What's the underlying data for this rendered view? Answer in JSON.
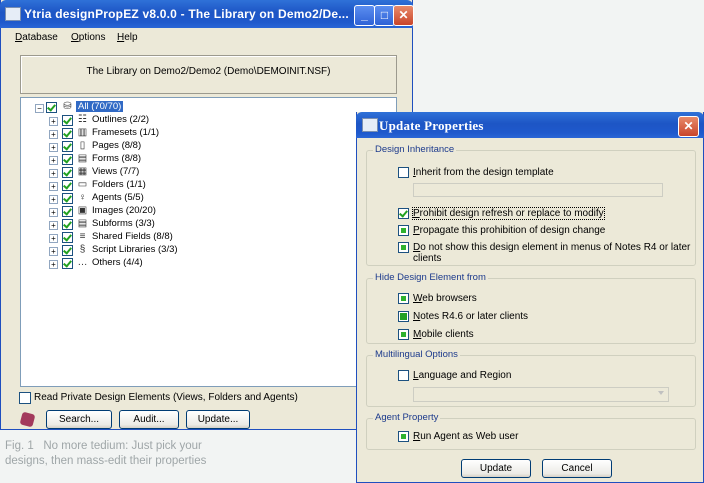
{
  "main": {
    "title": "Ytria designPropEZ v8.0.0 - The Library on Demo2/De...",
    "menu": [
      "Database",
      "Options",
      "Help"
    ],
    "database_path": "The Library on Demo2/Demo2 (Demo\\DEMOINIT.NSF)",
    "tree": [
      {
        "label": "All (70/70)",
        "icon": "database-icon",
        "selected": true
      },
      {
        "label": "Outlines (2/2)",
        "icon": "outline-icon"
      },
      {
        "label": "Framesets (1/1)",
        "icon": "frameset-icon"
      },
      {
        "label": "Pages (8/8)",
        "icon": "page-icon"
      },
      {
        "label": "Forms (8/8)",
        "icon": "form-icon"
      },
      {
        "label": "Views (7/7)",
        "icon": "view-icon"
      },
      {
        "label": "Folders (1/1)",
        "icon": "folder-icon"
      },
      {
        "label": "Agents (5/5)",
        "icon": "agent-icon"
      },
      {
        "label": "Images (20/20)",
        "icon": "image-icon"
      },
      {
        "label": "Subforms (3/3)",
        "icon": "subform-icon"
      },
      {
        "label": "Shared Fields (8/8)",
        "icon": "shared-field-icon"
      },
      {
        "label": "Script Libraries (3/3)",
        "icon": "script-library-icon"
      },
      {
        "label": "Others (4/4)",
        "icon": "ellipsis-icon"
      }
    ],
    "read_private_label": "Read Private Design Elements (Views, Folders and Agents)",
    "buttons": {
      "search": "Search...",
      "audit": "Audit...",
      "update": "Update..."
    }
  },
  "dialog": {
    "title": "Update Properties",
    "design_inheritance": {
      "heading": "Design Inheritance",
      "inherit": "Inherit from the design template",
      "prohibit": "Prohibit design refresh or replace to modify",
      "propagate": "Propagate this prohibition of design change",
      "do_not_show_1": "Do not show this design element in menus of Notes R4 or later",
      "do_not_show_2": "clients"
    },
    "hide_design": {
      "heading": "Hide Design Element from",
      "web": "Web browsers",
      "notes": "Notes R4.6 or later clients",
      "mobile": "Mobile clients"
    },
    "multilingual": {
      "heading": "Multilingual Options",
      "language": "Language and Region"
    },
    "agent": {
      "heading": "Agent Property",
      "run_as_web": "Run Agent as Web user"
    },
    "buttons": {
      "update": "Update",
      "cancel": "Cancel"
    }
  },
  "caption": {
    "line1": "Fig. 1   No more tedium: Just pick your",
    "line2": "designs, then mass-edit their properties"
  }
}
